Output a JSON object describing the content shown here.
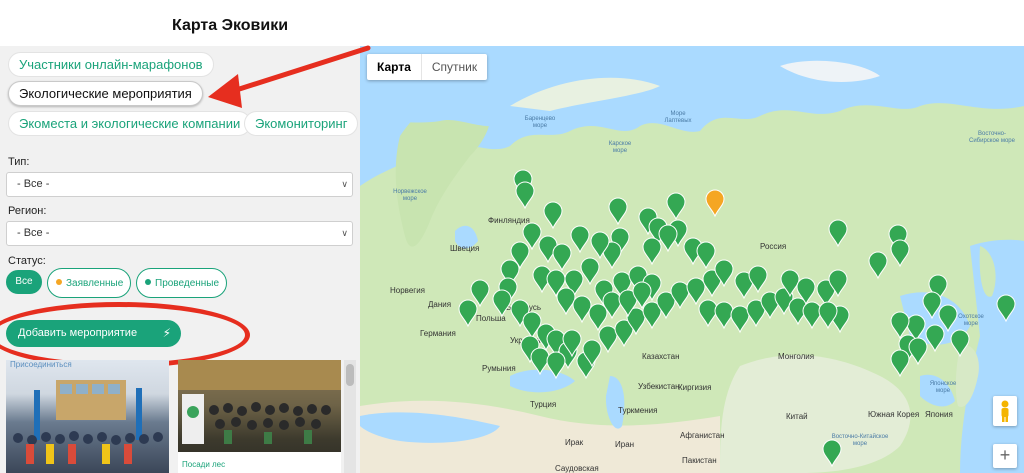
{
  "page_title": "Карта Эковики",
  "filters": {
    "category_tabs": [
      {
        "label": "Участники онлайн-марафонов"
      },
      {
        "label": "Экологические мероприятия"
      },
      {
        "label": "Экоместа и экологические компании"
      },
      {
        "label": "Экомониторинг"
      }
    ],
    "type_label": "Тип:",
    "type_value": "- Все -",
    "region_label": "Регион:",
    "region_value": "- Все -",
    "status_label": "Статус:",
    "status_options": [
      {
        "label": "Все"
      },
      {
        "label": "Заявленные",
        "dot_color": "#f5a623"
      },
      {
        "label": "Проведенные",
        "dot_color": "#1aa37a"
      }
    ],
    "add_event_label": "Добавить мероприятие"
  },
  "cards": [
    {
      "caption": "Присоединиться"
    },
    {
      "caption": "Посади лес"
    }
  ],
  "map": {
    "map_type_buttons": [
      "Карта",
      "Спутник"
    ],
    "zoom_in": "+",
    "labels": {
      "russia": "Россия",
      "kazakhstan": "Казахстан",
      "mongolia": "Монголия",
      "china": "Китай",
      "sweden": "Швеция",
      "finland": "Финляндия",
      "norway": "Норвегия",
      "denmark": "Дания",
      "germany": "Германия",
      "poland": "Польша",
      "romania": "Румыния",
      "ukraine": "Украина",
      "belarus": "Беларусь",
      "turkey": "Турция",
      "iran": "Иран",
      "iraq": "Ирак",
      "afghanistan": "Афганистан",
      "pakistan": "Пакистан",
      "uzbekistan": "Узбекистан",
      "kyrgyzstan": "Киргизия",
      "turkmenistan": "Туркмения",
      "saudi": "Саудовская",
      "japan": "Япония",
      "korea": "Южная Корея",
      "sea_barents": "Баренцево море",
      "sea_kara": "Карское море",
      "sea_laptev": "Море Лаптевых",
      "sea_norway": "Норвежское море",
      "sea_east_siberian": "Восточно-Сибирское море",
      "sea_okhotsk": "Охотское море",
      "sea_japan": "Японское море",
      "sea_east_china": "Восточно-Китайское море"
    },
    "pin_color_conducted": "#34a853",
    "pin_color_declared": "#f5a623",
    "pin_declared_count": 1
  }
}
